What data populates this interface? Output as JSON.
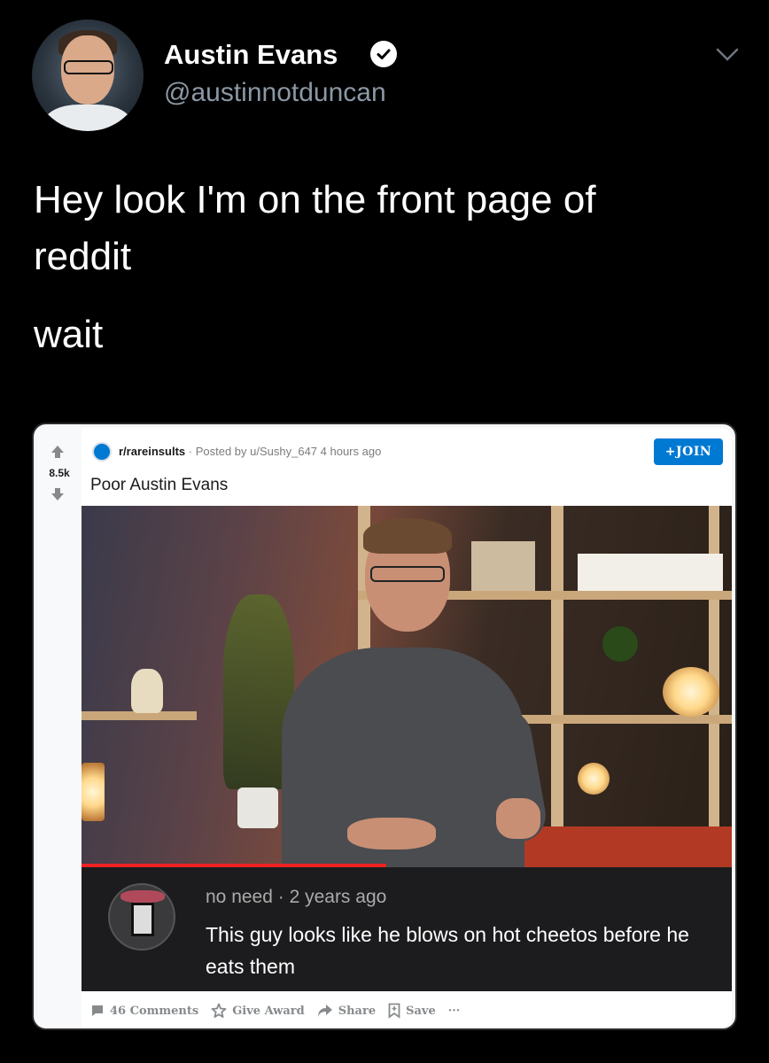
{
  "tweet": {
    "display_name": "Austin Evans",
    "handle": "@austinnotduncan",
    "text_line1": "Hey look I'm on the front page of",
    "text_line2": "reddit",
    "text_line3": "wait"
  },
  "reddit_post": {
    "subreddit": "r/rareinsults",
    "posted_by": "· Posted by u/Sushy_647 4 hours ago",
    "score": "8.5k",
    "join_label": "+JOIN",
    "title": "Poor Austin Evans",
    "comment": {
      "meta": "no need · 2 years ago",
      "text": "This guy looks like he blows on hot cheetos before he eats them"
    },
    "actions": {
      "comments": "46 Comments",
      "give_award": "Give Award",
      "share": "Share",
      "save": "Save",
      "more": "···"
    }
  },
  "colors": {
    "background": "#000000",
    "handle_gray": "#8b98a5",
    "reddit_blue": "#0079d3",
    "action_gray": "#878a8c"
  },
  "icons": [
    "verified-badge-icon",
    "chevron-down-icon",
    "upvote-arrow-icon",
    "downvote-arrow-icon",
    "subreddit-icon",
    "comment-icon",
    "award-icon",
    "share-arrow-icon",
    "save-bookmark-icon",
    "more-dots-icon"
  ]
}
